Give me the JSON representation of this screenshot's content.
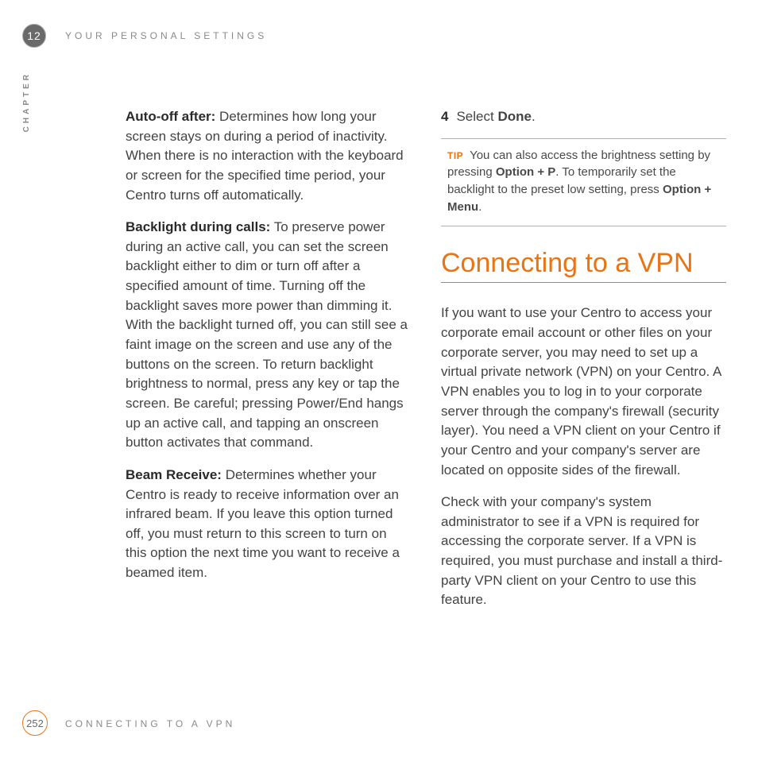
{
  "header": {
    "chapter_number": "12",
    "eyebrow": "YOUR PERSONAL SETTINGS",
    "vertical_label": "CHAPTER"
  },
  "left": {
    "p1_label": "Auto-off after:",
    "p1_body": " Determines how long your screen stays on during a period of inactivity. When there is no interaction with the keyboard or screen for the specified time period, your Centro turns off automatically.",
    "p2_label": "Backlight during calls:",
    "p2_body": " To preserve power during an active call, you can set the screen backlight either to dim or turn off after a specified amount of time. Turning off the backlight saves more power than dimming it. With the backlight turned off, you can still see a faint image on the screen and use any of the buttons on the screen. To return backlight brightness to normal, press any key or tap the screen. Be careful; pressing Power/End hangs up an active call, and tapping an onscreen button activates that command.",
    "p3_label": "Beam Receive:",
    "p3_body": " Determines whether your Centro is ready to receive information over an infrared beam. If you leave this option turned off, you must return to this screen to turn on this option the next time you want to receive a beamed item."
  },
  "right": {
    "step_num": "4",
    "step_pre": "Select ",
    "step_bold": "Done",
    "step_post": ".",
    "tip_label": "TIP",
    "tip_a": " You can also access the brightness setting by pressing ",
    "tip_b1": "Option + P",
    "tip_c": ". To temporarily set the backlight to the preset low setting, press ",
    "tip_b2": "Option + Menu",
    "tip_end": ".",
    "heading": "Connecting to a VPN",
    "p1": "If you want to use your Centro to access your corporate email account or other files on your corporate server, you may need to set up a virtual private network (VPN) on your Centro. A VPN enables you to log in to your corporate server through the company's firewall (security layer). You need a VPN client on your Centro if your Centro and your company's server are located on opposite sides of the firewall.",
    "p2": "Check with your company's system administrator to see if a VPN is required for accessing the corporate server. If a VPN is required, you must purchase and install a third-party VPN client on your Centro to use this feature."
  },
  "footer": {
    "page_number": "252",
    "section": "CONNECTING TO A VPN"
  }
}
